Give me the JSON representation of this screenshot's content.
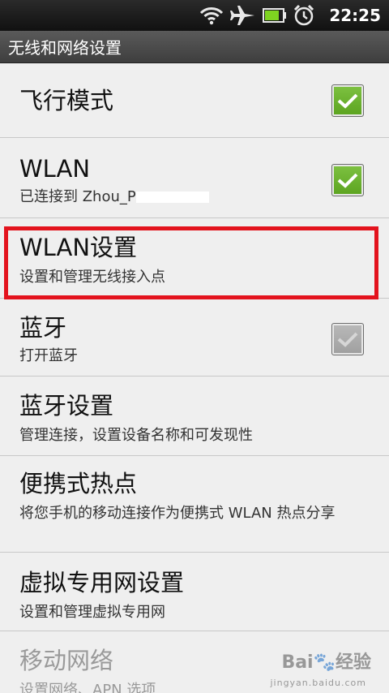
{
  "status_bar": {
    "time": "22:25",
    "icons": [
      "wifi-icon",
      "airplane-icon",
      "battery-icon",
      "alarm-icon"
    ],
    "battery_color": "#7ed321"
  },
  "title": "无线和网络设置",
  "items": [
    {
      "title": "飞行模式",
      "checked": true
    },
    {
      "title": "WLAN",
      "summary": "已连接到 Zhou_P",
      "checked": true
    },
    {
      "title": "WLAN设置",
      "summary": "设置和管理无线接入点",
      "highlighted": true
    },
    {
      "title": "蓝牙",
      "summary": "打开蓝牙",
      "checked": true,
      "disabled": true
    },
    {
      "title": "蓝牙设置",
      "summary": "管理连接，设置设备名称和可发现性"
    },
    {
      "title": "便携式热点",
      "summary": "将您手机的移动连接作为便携式 WLAN 热点分享"
    },
    {
      "title": "虚拟专用网设置",
      "summary": "设置和管理虚拟专用网"
    },
    {
      "title": "移动网络",
      "summary": "设置网络、APN 选项",
      "dimmed": true
    }
  ],
  "colors": {
    "highlight_border": "#e3131d",
    "checkbox_green": "#6bb22e"
  }
}
